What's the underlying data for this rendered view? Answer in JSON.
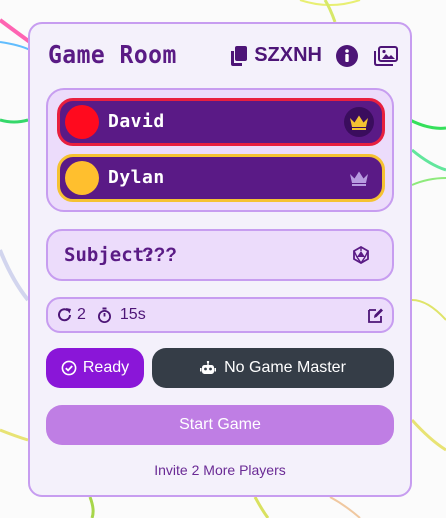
{
  "colors": {
    "panel_bg": "#f4f1fb",
    "panel_border": "#c79df0",
    "accent_purple": "#8a16d8",
    "player_bg": "#5a1a86",
    "dark_button": "#353d47",
    "start_button": "#bf7ee4"
  },
  "header": {
    "title": "Game Room",
    "room_code": "SZXNH",
    "icons": [
      "copy-icon",
      "info-icon",
      "images-icon"
    ]
  },
  "players": [
    {
      "name": "David",
      "color": "#ff0a1e",
      "border": "#e81f3f",
      "role": "host",
      "crown_color": "#f5c232"
    },
    {
      "name": "Dylan",
      "color": "#ffbf2e",
      "border": "#f5c232",
      "role": "player",
      "crown_color": "#b79be0"
    }
  ],
  "subject": {
    "label": "Subject:",
    "value": "???",
    "icon": "dice-d20-icon"
  },
  "settings": {
    "rounds": "2",
    "time": "15s",
    "icons": [
      "redo-icon",
      "stopwatch-icon",
      "edit-icon"
    ]
  },
  "actions": {
    "ready_label": "Ready",
    "game_master_label": "No Game Master",
    "start_label": "Start Game",
    "invite_text": "Invite 2 More Players"
  }
}
